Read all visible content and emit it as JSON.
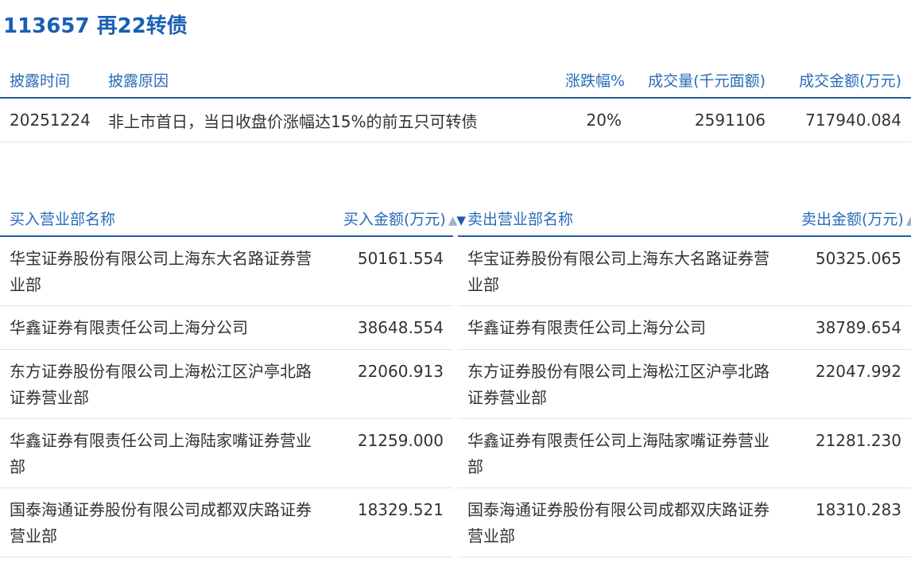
{
  "header": {
    "title": "113657 再22转债"
  },
  "summary": {
    "columns": [
      "披露时间",
      "披露原因",
      "涨跌幅%",
      "成交量(千元面额)",
      "成交金额(万元)"
    ],
    "row": {
      "date": "20251224",
      "reason": "非上市首日，当日收盘价涨幅达15%的前五只可转债",
      "change_pct": "20%",
      "volume": "2591106",
      "amount": "717940.084"
    }
  },
  "buy": {
    "columns": {
      "name": "买入营业部名称",
      "amount": "买入金额(万元)"
    },
    "rows": [
      {
        "name": "华宝证券股份有限公司上海东大名路证券营业部",
        "amount": "50161.554"
      },
      {
        "name": "华鑫证券有限责任公司上海分公司",
        "amount": "38648.554"
      },
      {
        "name": "东方证券股份有限公司上海松江区沪亭北路证券营业部",
        "amount": "22060.913"
      },
      {
        "name": "华鑫证券有限责任公司上海陆家嘴证券营业部",
        "amount": "21259.000"
      },
      {
        "name": "国泰海通证券股份有限公司成都双庆路证券营业部",
        "amount": "18329.521"
      }
    ]
  },
  "sell": {
    "columns": {
      "name": "卖出营业部名称",
      "amount": "卖出金额(万元)"
    },
    "rows": [
      {
        "name": "华宝证券股份有限公司上海东大名路证券营业部",
        "amount": "50325.065"
      },
      {
        "name": "华鑫证券有限责任公司上海分公司",
        "amount": "38789.654"
      },
      {
        "name": "东方证券股份有限公司上海松江区沪亭北路证券营业部",
        "amount": "22047.992"
      },
      {
        "name": "华鑫证券有限责任公司上海陆家嘴证券营业部",
        "amount": "21281.230"
      },
      {
        "name": "国泰海通证券股份有限公司成都双庆路证券营业部",
        "amount": "18310.283"
      }
    ]
  },
  "icons": {
    "sort": "sort-toggle-icon"
  }
}
